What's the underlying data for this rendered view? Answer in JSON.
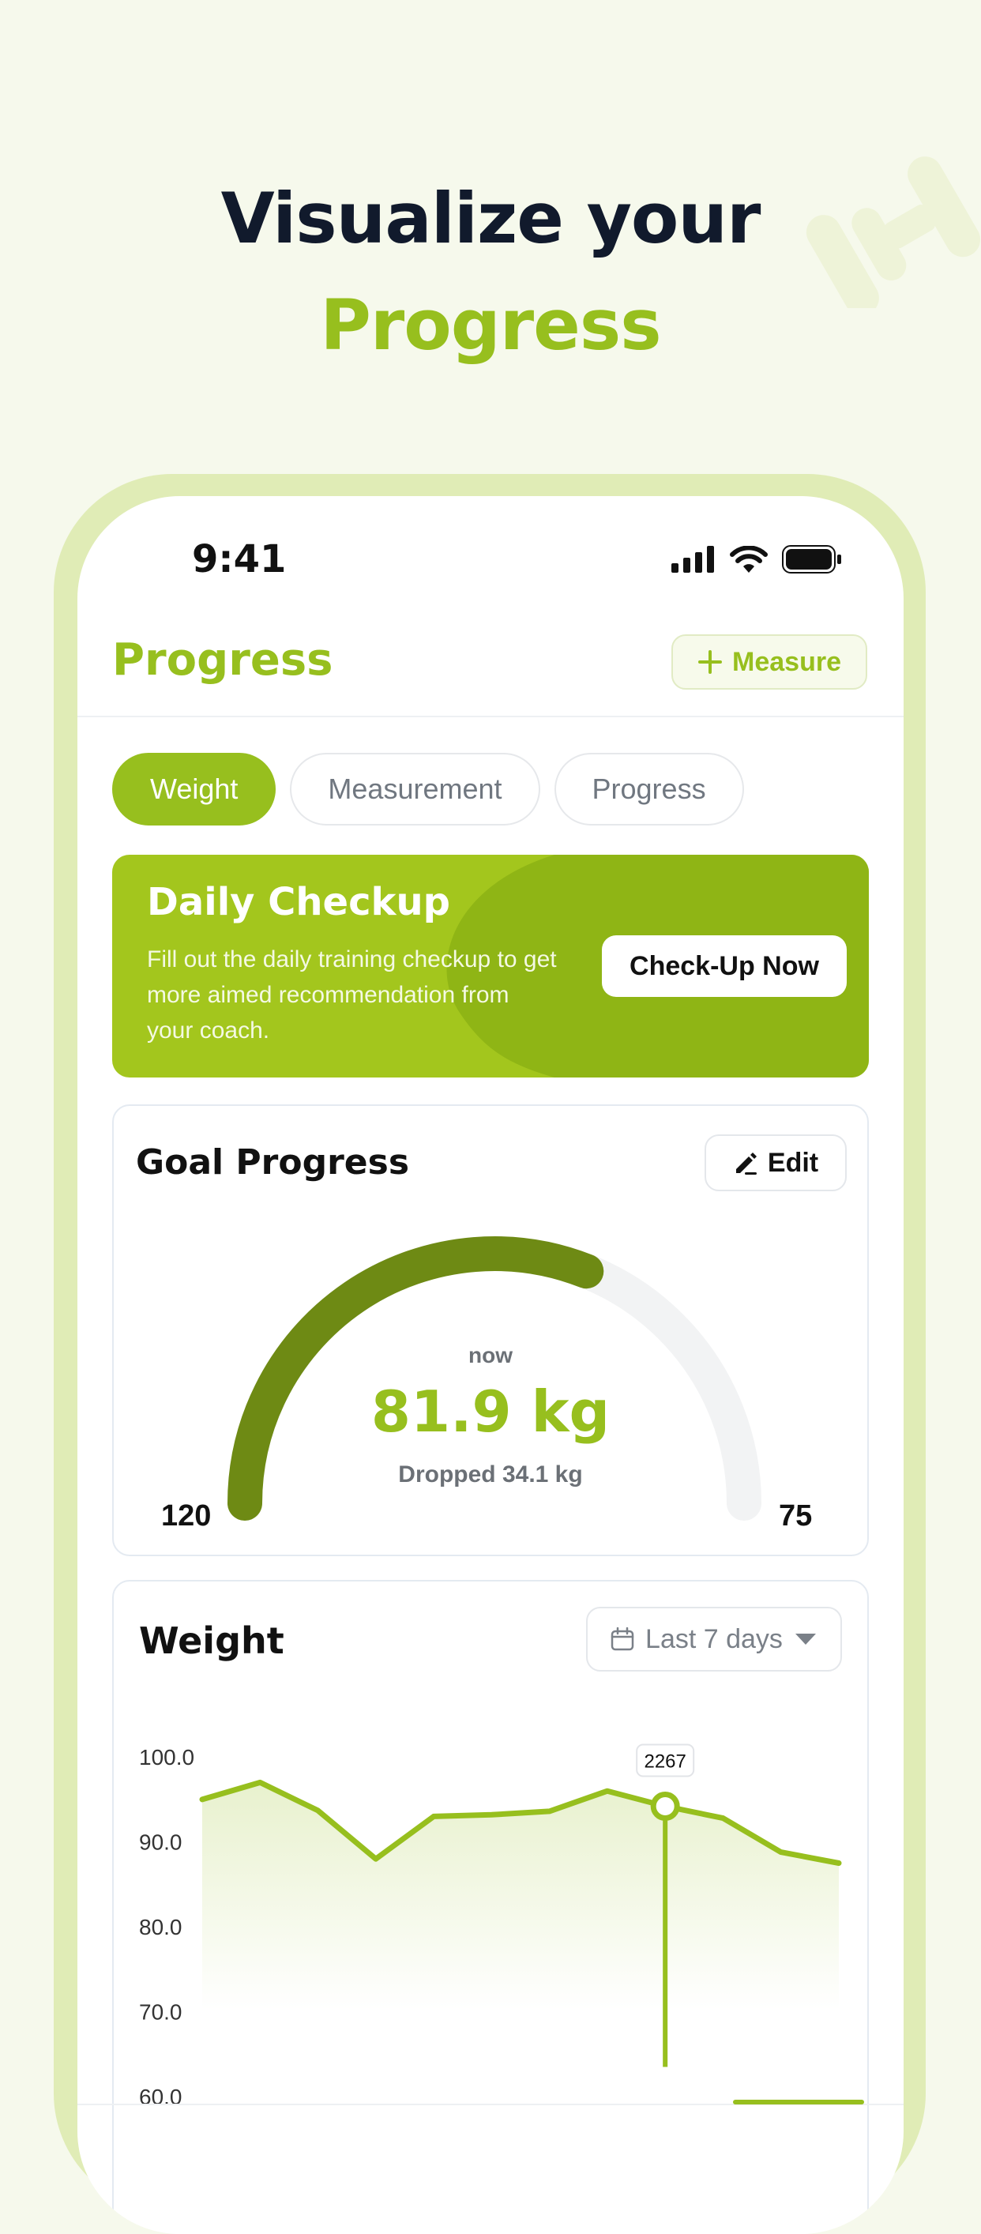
{
  "headline": {
    "line1": "Visualize your",
    "line2": "Progress"
  },
  "status_bar": {
    "time": "9:41"
  },
  "header": {
    "title": "Progress",
    "measure_label": "Measure"
  },
  "tabs": [
    {
      "label": "Weight",
      "active": true
    },
    {
      "label": "Measurement",
      "active": false
    },
    {
      "label": "Progress",
      "active": false
    }
  ],
  "checkup": {
    "title": "Daily Checkup",
    "text": "Fill out the daily training checkup to get more aimed recommendation from your coach.",
    "button_label": "Check-Up Now"
  },
  "goal": {
    "title": "Goal Progress",
    "edit_label": "Edit",
    "now_label": "now",
    "current": "81.9 kg",
    "dropped": "Dropped 34.1 kg",
    "start": "120",
    "target": "75",
    "fraction": 0.62
  },
  "weight_card": {
    "title": "Weight",
    "range_label": "Last 7 days"
  },
  "chart_data": {
    "type": "area",
    "y_ticks": [
      "100.0",
      "90.0",
      "80.0",
      "70.0",
      "60.0"
    ],
    "ylim": [
      60,
      100
    ],
    "values": [
      94.8,
      96.8,
      93.5,
      87.8,
      92.8,
      93.0,
      93.4,
      95.8,
      94.0,
      92.6,
      88.6,
      87.3
    ],
    "highlight_index": 8,
    "tooltip": "2267"
  },
  "colors": {
    "accent": "#97bf1e",
    "accent_dark": "#6e8a14",
    "text_dark": "#111a2c"
  }
}
